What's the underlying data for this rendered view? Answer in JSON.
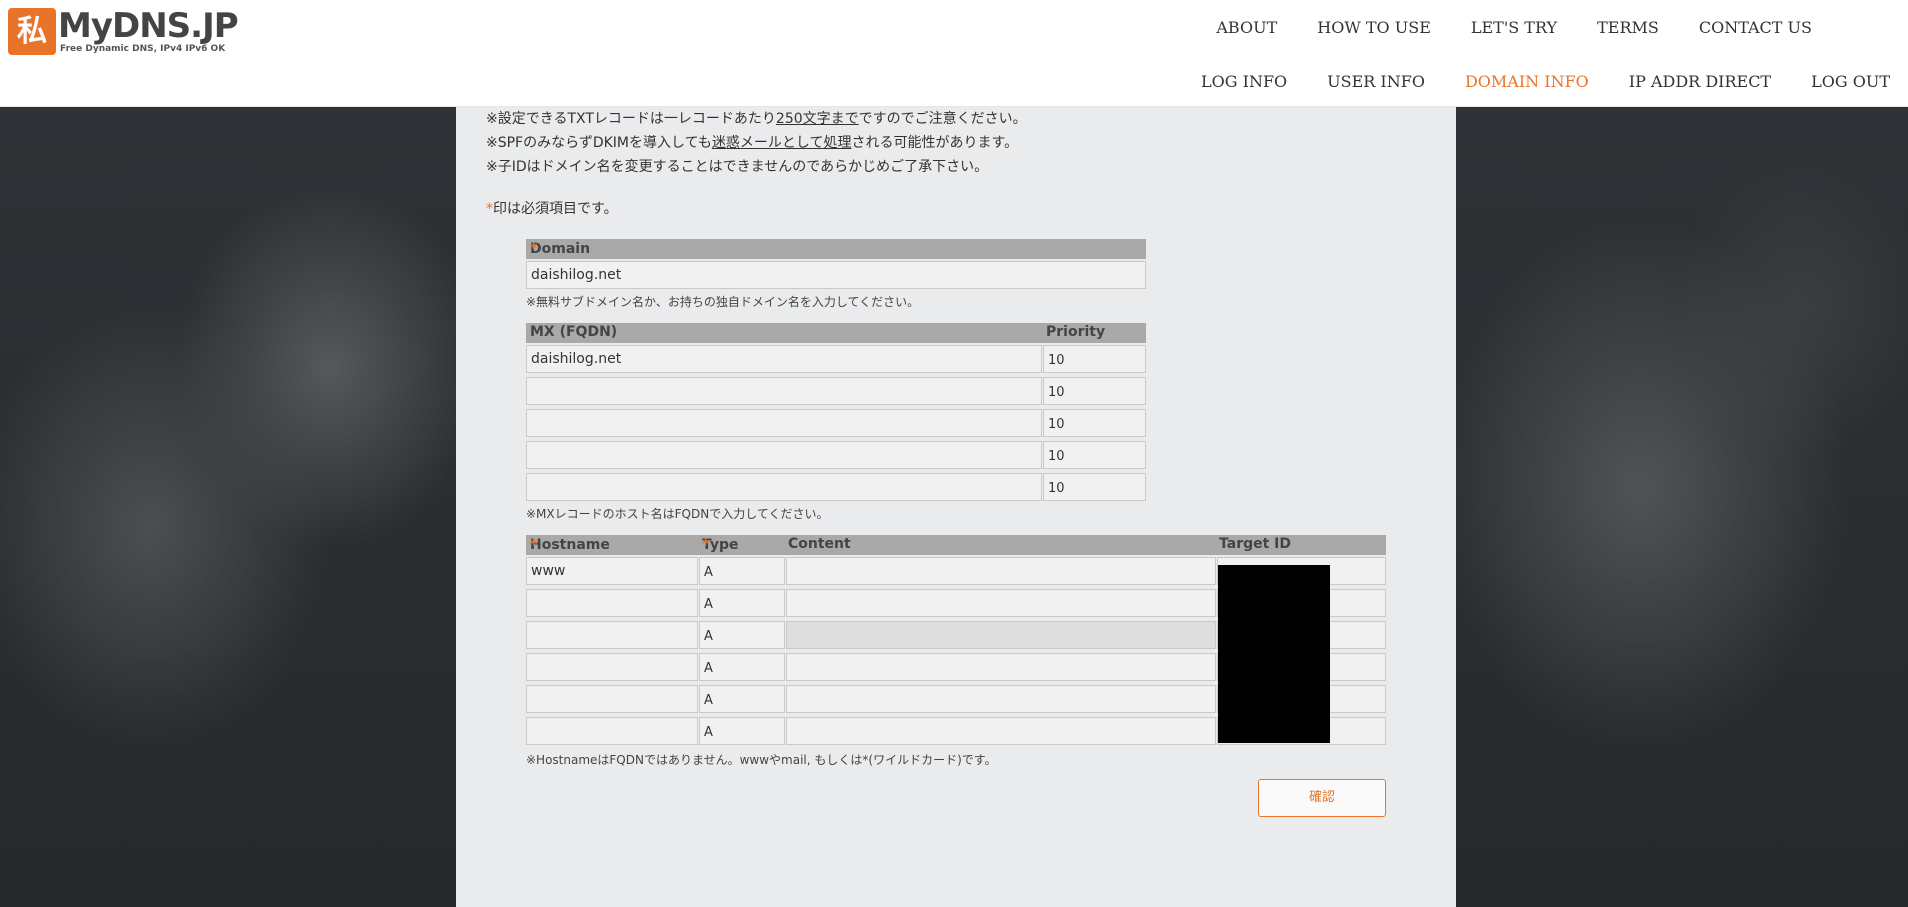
{
  "header": {
    "logo_mark": "私",
    "logo_text": "MyDNS.JP",
    "logo_sub": "Free Dynamic DNS, IPv4 IPv6 OK",
    "nav_top": [
      "ABOUT",
      "HOW TO USE",
      "LET'S TRY",
      "TERMS",
      "CONTACT US"
    ],
    "nav_bottom": [
      "LOG INFO",
      "USER INFO",
      "DOMAIN INFO",
      "IP ADDR DIRECT",
      "LOG OUT"
    ],
    "active_item": "DOMAIN INFO",
    "accent": "#e8742a"
  },
  "notes": {
    "line1_pre": "※設定できるTXTレコードは一レコードあたり",
    "line1_u": "250文字まで",
    "line1_post": "ですのでご注意ください。",
    "line2_pre": "※SPFのみならずDKIMを導入しても",
    "line2_u": "迷惑メールとして処理",
    "line2_post": "される可能性があります。",
    "line3": "※子IDはドメイン名を変更することはできませんのであらかじめご了承下さい。",
    "required_mark": "*",
    "required": "印は必須項目です。"
  },
  "domain": {
    "label": "Domain",
    "value": "daishilog.net",
    "hint": "※無料サブドメイン名か、お持ちの独自ドメイン名を入力してください。"
  },
  "mx": {
    "label_host": "MX (FQDN)",
    "label_priority": "Priority",
    "rows": [
      {
        "host": "daishilog.net",
        "priority": "10"
      },
      {
        "host": "",
        "priority": "10"
      },
      {
        "host": "",
        "priority": "10"
      },
      {
        "host": "",
        "priority": "10"
      },
      {
        "host": "",
        "priority": "10"
      }
    ],
    "hint": "※MXレコードのホスト名はFQDNで入力してください。"
  },
  "records": {
    "label_hostname": "Hostname",
    "label_type": "Type",
    "label_content": "Content",
    "label_target": "Target ID",
    "rows": [
      {
        "hostname": "www",
        "type": "A",
        "content": "",
        "target": ""
      },
      {
        "hostname": "",
        "type": "A",
        "content": "",
        "target": ""
      },
      {
        "hostname": "",
        "type": "A",
        "content": "",
        "target": ""
      },
      {
        "hostname": "",
        "type": "A",
        "content": "",
        "target": ""
      },
      {
        "hostname": "",
        "type": "A",
        "content": "",
        "target": ""
      },
      {
        "hostname": "",
        "type": "A",
        "content": "",
        "target": ""
      }
    ],
    "hint": "※HostnameはFQDNではありません。wwwやmail, もしくは*(ワイルドカード)です。"
  },
  "confirm_label": "確認"
}
